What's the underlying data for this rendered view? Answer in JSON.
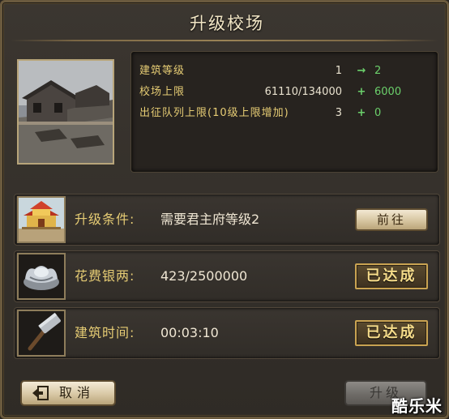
{
  "dialog": {
    "title": "升级校场"
  },
  "stats": [
    {
      "label": "建筑等级",
      "current": "1",
      "symbol": "→",
      "next": "2"
    },
    {
      "label": "校场上限",
      "current": "61110/134000",
      "symbol": "+",
      "next": "6000"
    },
    {
      "label": "出征队列上限(10级上限增加)",
      "current": "3",
      "symbol": "+",
      "next": "0"
    }
  ],
  "requirements": [
    {
      "label": "升级条件:",
      "value": "需要君主府等级2",
      "action": "前往",
      "icon": "palace-icon"
    },
    {
      "label": "花费银两:",
      "value": "423/2500000",
      "status": "已达成",
      "icon": "silver-ingot-icon"
    },
    {
      "label": "建筑时间:",
      "value": "00:03:10",
      "status": "已达成",
      "icon": "hammer-icon"
    }
  ],
  "footer": {
    "cancel_label": "取消",
    "upgrade_label": "升级"
  },
  "watermark": "酷乐米",
  "colors": {
    "label_gold": "#e6cc74",
    "increase_green": "#6bd06b",
    "frame_border": "#6a5a3e"
  }
}
